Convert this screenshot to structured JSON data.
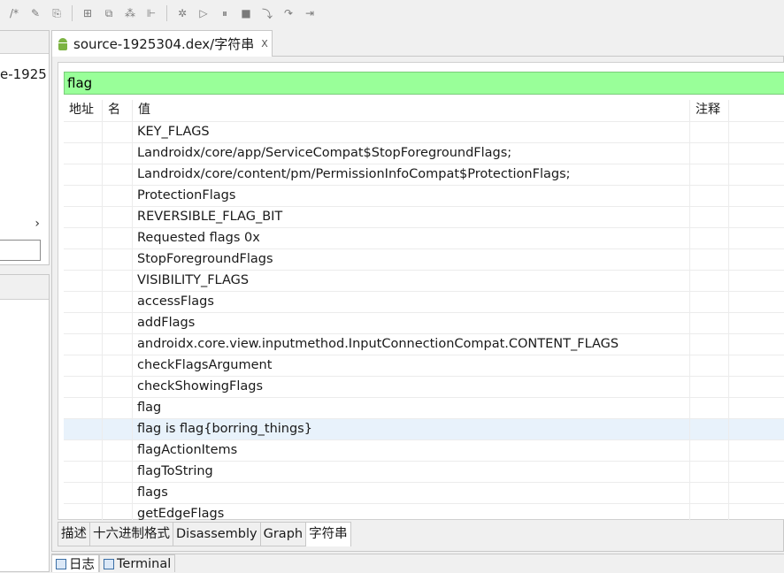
{
  "toolbar": {
    "icons": [
      "comment-icon",
      "pencil-icon",
      "export-icon",
      "grid-icon",
      "class-hierarchy-icon",
      "graph-icon",
      "structure-icon",
      "debug-icon",
      "run-icon",
      "pause-icon",
      "stop-icon",
      "step-into-icon",
      "step-over-icon",
      "step-out-icon"
    ]
  },
  "left_panel": {
    "project_text": "e-1925",
    "chevron": "›"
  },
  "editor": {
    "tab_title": "source-1925304.dex/字符串",
    "tab_close": "ⵝ"
  },
  "strings_view": {
    "filter_value": "flag",
    "columns": {
      "address": "地址",
      "name": "名",
      "value": "值",
      "comment": "注释"
    },
    "rows": [
      "KEY_FLAGS",
      "Landroidx/core/app/ServiceCompat$StopForegroundFlags;",
      "Landroidx/core/content/pm/PermissionInfoCompat$ProtectionFlags;",
      "ProtectionFlags",
      "REVERSIBLE_FLAG_BIT",
      "Requested flags 0x",
      "StopForegroundFlags",
      "VISIBILITY_FLAGS",
      "accessFlags",
      "addFlags",
      "androidx.core.view.inputmethod.InputConnectionCompat.CONTENT_FLAGS",
      "checkFlagsArgument",
      "checkShowingFlags",
      "flag",
      "flag is flag{borring_things}",
      "flagActionItems",
      "flagToString",
      "flags",
      "getEdgeFlags"
    ],
    "selected_row": "flag is flag{borring_things}"
  },
  "bottom_tabs": [
    "描述",
    "十六进制格式",
    "Disassembly",
    "Graph",
    "字符串"
  ],
  "active_bottom_tab": "字符串",
  "console_tabs": [
    "日志",
    "Terminal"
  ],
  "colors": {
    "filter_bg": "#99ff99",
    "selected_row": "#e8f2fb",
    "android_green": "#7cb342"
  }
}
